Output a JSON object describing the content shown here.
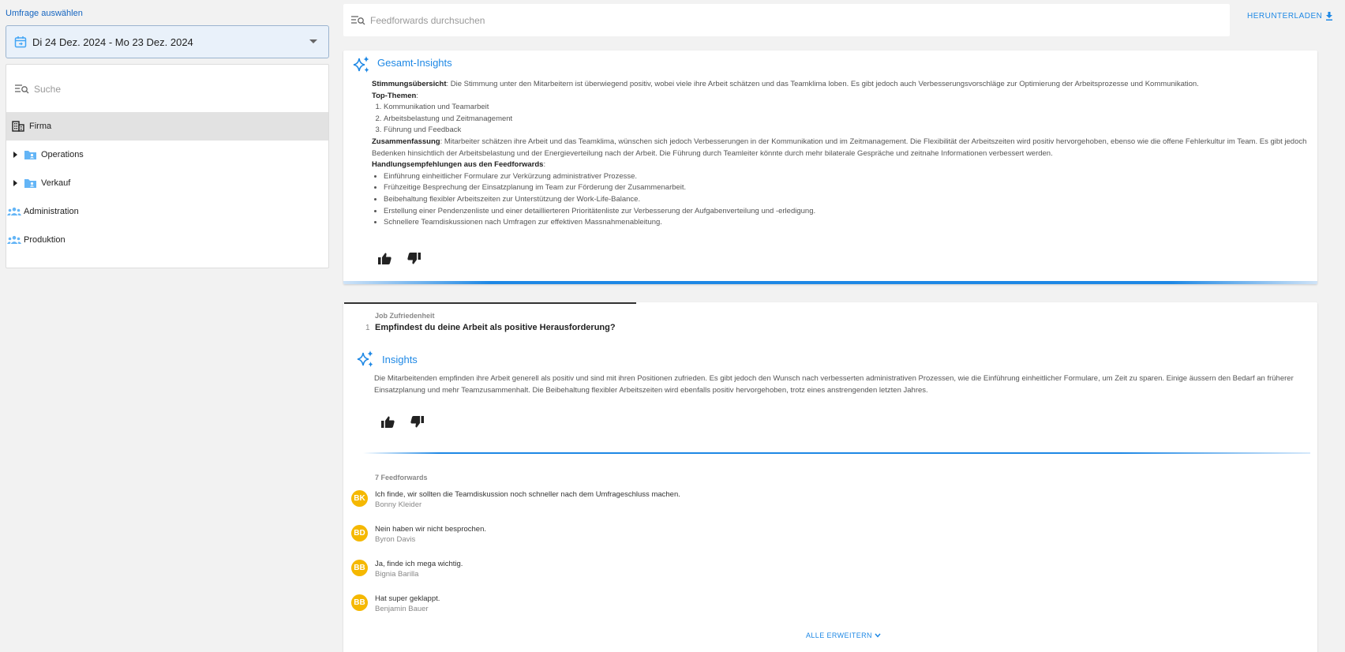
{
  "sidebar": {
    "survey_label": "Umfrage auswählen",
    "date_range": "Di 24 Dez. 2024 - Mo 23 Dez. 2024",
    "search_placeholder": "Suche",
    "items": [
      {
        "label": "Firma",
        "icon": "building-icon",
        "selected": true
      },
      {
        "label": "Operations",
        "icon": "folder-user-icon",
        "expandable": true
      },
      {
        "label": "Verkauf",
        "icon": "folder-user-icon",
        "expandable": true
      },
      {
        "label": "Administration",
        "icon": "group-icon"
      },
      {
        "label": "Produktion",
        "icon": "group-icon"
      }
    ]
  },
  "header": {
    "search_placeholder": "Feedforwards durchsuchen",
    "download_label": "HERUNTERLADEN"
  },
  "overall_insights": {
    "title": "Gesamt-Insights",
    "mood_label": "Stimmungsübersicht",
    "mood_text": ": Die Stimmung unter den Mitarbeitern ist überwiegend positiv, wobei viele ihre Arbeit schätzen und das Teamklima loben. Es gibt jedoch auch Verbesserungsvorschläge zur Optimierung der Arbeitsprozesse und Kommunikation.",
    "topics_label": "Top-Themen",
    "topics_colon": ":",
    "topics": [
      "Kommunikation und Teamarbeit",
      "Arbeitsbelastung und Zeitmanagement",
      "Führung und Feedback"
    ],
    "summary_label": "Zusammenfassung",
    "summary_text": ": Mitarbeiter schätzen ihre Arbeit und das Teamklima, wünschen sich jedoch Verbesserungen in der Kommunikation und im Zeitmanagement. Die Flexibilität der Arbeitszeiten wird positiv hervorgehoben, ebenso wie die offene Fehlerkultur im Team. Es gibt jedoch Bedenken hinsichtlich der Arbeitsbelastung und der Energieverteilung nach der Arbeit. Die Führung durch Teamleiter könnte durch mehr bilaterale Gespräche und zeitnahe Informationen verbessert werden.",
    "recommend_label": "Handlungsempfehlungen aus den Feedforwards",
    "recommend_colon": ":",
    "recommendations": [
      "Einführung einheitlicher Formulare zur Verkürzung administrativer Prozesse.",
      "Frühzeitige Besprechung der Einsatzplanung im Team zur Förderung der Zusammenarbeit.",
      "Beibehaltung flexibler Arbeitszeiten zur Unterstützung der Work-Life-Balance.",
      "Erstellung einer Pendenzenliste und einer detaillierteren Prioritätenliste zur Verbesserung der Aufgabenverteilung und -erledigung.",
      "Schnellere Teamdiskussionen nach Umfragen zur effektiven Massnahmenableitung."
    ]
  },
  "question": {
    "category": "Job Zufriedenheit",
    "number": "1",
    "text": "Empfindest du deine Arbeit als positive Herausforderung?",
    "insights_title": "Insights",
    "insights_text": "Die Mitarbeitenden empfinden ihre Arbeit generell als positiv und sind mit ihren Positionen zufrieden. Es gibt jedoch den Wunsch nach verbesserten administrativen Prozessen, wie die Einführung einheitlicher Formulare, um Zeit zu sparen. Einige äussern den Bedarf an früherer Einsatzplanung und mehr Teamzusammenhalt. Die Beibehaltung flexibler Arbeitszeiten wird ebenfalls positiv hervorgehoben, trotz eines anstrengenden letzten Jahres.",
    "feedforward_count": "7 Feedforwards",
    "feedforwards": [
      {
        "initials": "BK",
        "text": "Ich finde, wir sollten die Teamdiskussion noch schneller nach dem Umfrageschluss machen.",
        "author": "Bonny Kleider"
      },
      {
        "initials": "BD",
        "text": "Nein haben wir nicht besprochen.",
        "author": "Byron Davis"
      },
      {
        "initials": "BB",
        "text": "Ja, finde ich mega wichtig.",
        "author": "Bignia Barilla"
      },
      {
        "initials": "BB",
        "text": "Hat super geklappt.",
        "author": "Benjamin Bauer"
      }
    ],
    "expand_label": "ALLE ERWEITERN"
  },
  "colors": {
    "accent": "#1e88e5",
    "avatar": "#f5b800",
    "folder": "#64b5f6"
  }
}
